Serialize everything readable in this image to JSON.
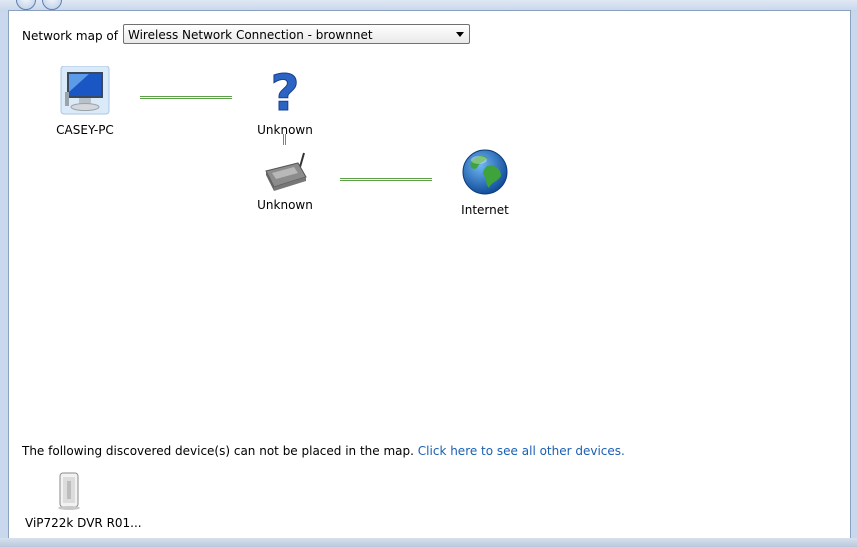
{
  "network_map": {
    "label": "Network map of",
    "selected_connection": "Wireless Network Connection - brownnet"
  },
  "nodes": {
    "pc": "CASEY-PC",
    "unknown_top": "Unknown",
    "unknown_router": "Unknown",
    "internet": "Internet"
  },
  "discovered": {
    "text": "The following discovered device(s) can not be placed in the map.",
    "link": "Click here to see all other devices.",
    "device_label": "ViP722k DVR R01..."
  },
  "colors": {
    "link_line": "#5ea04a",
    "link_text": "#1a5fb4"
  }
}
